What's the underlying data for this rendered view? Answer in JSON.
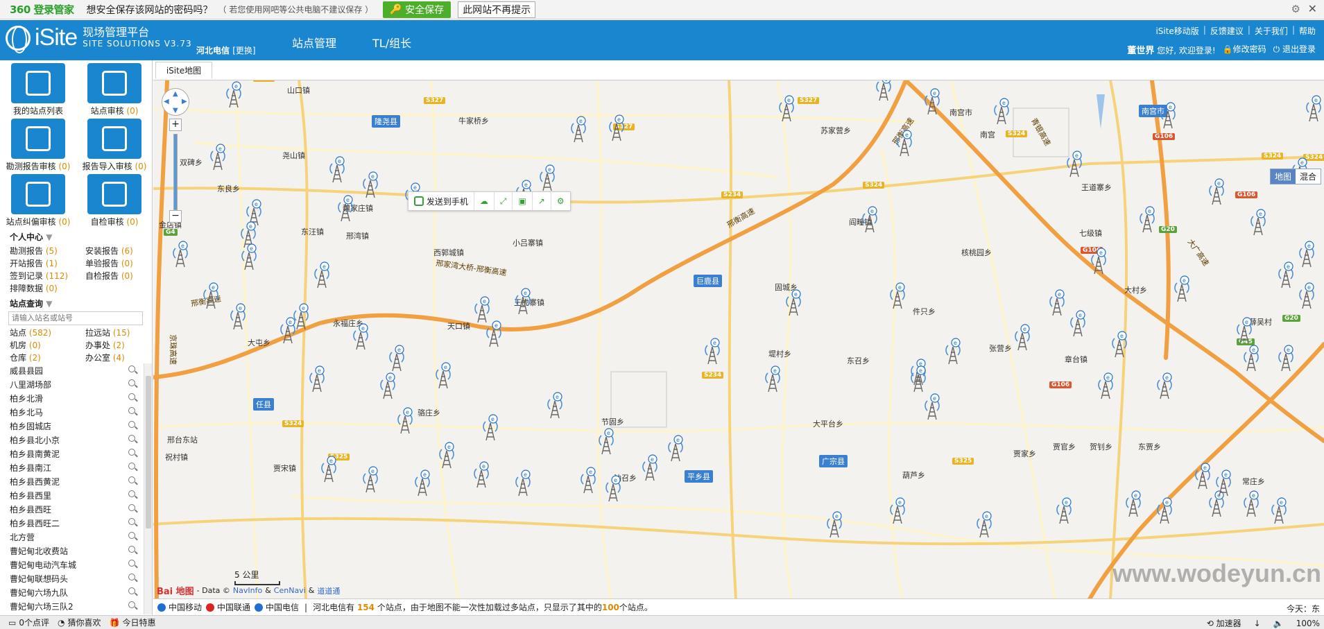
{
  "pwbar": {
    "logo": "360 登录管家",
    "question": "想安全保存该网站的密码吗？",
    "hint": "（ 若您使用网吧等公共电脑不建议保存 ）",
    "save_label": "安全保存",
    "never_label": "此网站不再提示"
  },
  "header": {
    "brand": "iSite",
    "title_cn": "现场管理平台",
    "title_en": "SITE SOLUTIONS",
    "version": "V3.73",
    "province": "河北电信",
    "change_label": "[更换]",
    "nav": [
      "站点管理",
      "TL/组长"
    ],
    "links": [
      "iSite移动版",
      "反馈建议",
      "关于我们",
      "帮助"
    ],
    "user_name": "董世界",
    "greeting": "您好, 欢迎登录!",
    "change_pwd": "修改密码",
    "logout": "退出登录"
  },
  "left": {
    "tiles": [
      {
        "label": "我的站点列表",
        "count": ""
      },
      {
        "label": "站点审核",
        "count": "(0)"
      },
      {
        "label": "勘测报告审核",
        "count": "(0)"
      },
      {
        "label": "报告导入审核",
        "count": "(0)"
      },
      {
        "label": "站点纠偏审核",
        "count": "(0)"
      },
      {
        "label": "自检审核",
        "count": "(0)"
      }
    ],
    "personal_title": "个人中心",
    "personal": [
      {
        "label": "勘测报告",
        "count": "(5)"
      },
      {
        "label": "安装报告",
        "count": "(6)"
      },
      {
        "label": "开站报告",
        "count": "(1)"
      },
      {
        "label": "单验报告",
        "count": "(0)"
      },
      {
        "label": "签到记录",
        "count": "(112)"
      },
      {
        "label": "自检报告",
        "count": "(0)"
      },
      {
        "label": "排障数据",
        "count": "(0)"
      }
    ],
    "query_title": "站点查询",
    "search_placeholder": "请输入站名或站号",
    "categories": [
      {
        "label": "站点",
        "count": "(582)"
      },
      {
        "label": "拉远站",
        "count": "(15)"
      },
      {
        "label": "机房",
        "count": "(0)"
      },
      {
        "label": "办事处",
        "count": "(2)"
      },
      {
        "label": "仓库",
        "count": "(2)"
      },
      {
        "label": "办公室",
        "count": "(4)"
      }
    ],
    "sites": [
      "威县县园",
      "八里湖场部",
      "柏乡北滑",
      "柏乡北马",
      "柏乡固城店",
      "柏乡县北小京",
      "柏乡县南黄泥",
      "柏乡县南江",
      "柏乡县西黄泥",
      "柏乡县西里",
      "柏乡县西旺",
      "柏乡县西旺二",
      "北方营",
      "曹妃甸北收费站",
      "曹妃甸电动汽车城",
      "曹妃甸联想码头",
      "曹妃甸六场九队",
      "曹妃甸六场三队2"
    ]
  },
  "map": {
    "tab": "iSite地图",
    "toolbar_send": "发送到手机",
    "maptype_on": "地图",
    "maptype_off": "混合",
    "scale": "5 公里",
    "attrib_baidu": "Bai 地图",
    "attrib_text": "- Data ©",
    "attrib_navinfo": "NavInfo",
    "attrib_amp": "&",
    "attrib_cennavi": "CenNavi",
    "attrib_amp2": "&",
    "attrib_daodao": "道道通",
    "watermark": "www.wodeyun.cn",
    "places": [
      "山口镇",
      "牛家桥乡",
      "双碑乡",
      "尧山镇",
      "东良乡",
      "金店镇",
      "魏家庄镇",
      "东汪镇",
      "邢湾镇",
      "西郭城镇",
      "小吕寨镇",
      "王虎寨镇",
      "大屯乡",
      "天口镇",
      "永福庄乡",
      "苏家营乡",
      "阎疃镇",
      "固城乡",
      "核桃园乡",
      "件只乡",
      "堤村乡",
      "东召乡",
      "张营乡",
      "章台镇",
      "大平台乡",
      "骆庄乡",
      "节固乡",
      "祝村镇",
      "贾宋镇",
      "油召乡",
      "葫芦乡",
      "王道寨乡",
      "七级镇",
      "南宫市",
      "贾官乡",
      "大村乡",
      "常庄乡",
      "南宫",
      "薛吴村",
      "邢台东站",
      "贾家乡",
      "东贾乡",
      "贺钊乡"
    ],
    "cities": [
      "隆尧县",
      "巨鹿县",
      "任县",
      "平乡县",
      "广宗县",
      "南宫市"
    ],
    "road_labels": [
      "邢衡高速",
      "邢家湾大桥-邢衡高速",
      "邢衡高速",
      "京珠高速",
      "青银高速",
      "大广高速",
      "邢衡高速"
    ],
    "shields_s": [
      "S327",
      "S327",
      "S234",
      "S327",
      "S327",
      "S324",
      "S324",
      "S324",
      "S234",
      "S234",
      "S324",
      "S325",
      "S325",
      "S324"
    ],
    "shields_g": [
      "G4",
      "G20",
      "G20",
      "G45",
      "G20"
    ],
    "shields_r": [
      "G106",
      "G106",
      "G106",
      "G106"
    ]
  },
  "status": {
    "carriers": [
      "中国移动",
      "中国联通",
      "中国电信"
    ],
    "prefix": "河北电信有",
    "count": "154",
    "mid": "个站点，由于地图不能一次性加载过多站点，只显示了其中的",
    "shown": "100",
    "suffix": "个站点。",
    "today": "今天：东"
  },
  "taskbar": {
    "left1": "0个点评",
    "left2": "猜你喜欢",
    "left3": "今日特惠",
    "accel": "加速器",
    "zoom": "100%"
  },
  "colors": {
    "header_blue": "#1a86cf",
    "accent_orange": "#e08a00",
    "save_green": "#4cae2b"
  }
}
